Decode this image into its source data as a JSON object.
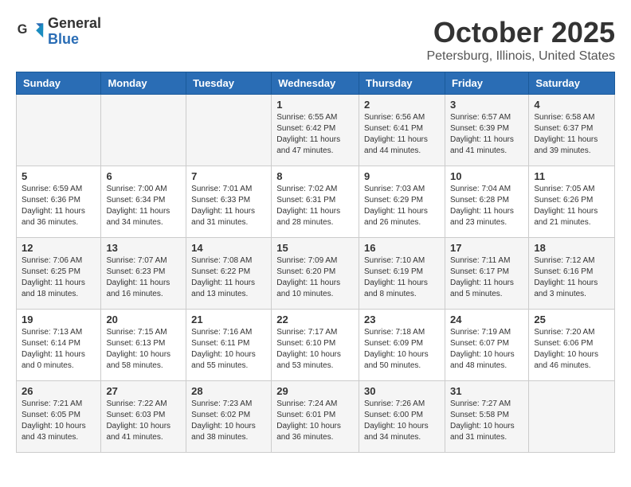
{
  "header": {
    "logo_line1": "General",
    "logo_line2": "Blue",
    "month": "October 2025",
    "location": "Petersburg, Illinois, United States"
  },
  "weekdays": [
    "Sunday",
    "Monday",
    "Tuesday",
    "Wednesday",
    "Thursday",
    "Friday",
    "Saturday"
  ],
  "weeks": [
    [
      {
        "day": "",
        "info": ""
      },
      {
        "day": "",
        "info": ""
      },
      {
        "day": "",
        "info": ""
      },
      {
        "day": "1",
        "info": "Sunrise: 6:55 AM\nSunset: 6:42 PM\nDaylight: 11 hours\nand 47 minutes."
      },
      {
        "day": "2",
        "info": "Sunrise: 6:56 AM\nSunset: 6:41 PM\nDaylight: 11 hours\nand 44 minutes."
      },
      {
        "day": "3",
        "info": "Sunrise: 6:57 AM\nSunset: 6:39 PM\nDaylight: 11 hours\nand 41 minutes."
      },
      {
        "day": "4",
        "info": "Sunrise: 6:58 AM\nSunset: 6:37 PM\nDaylight: 11 hours\nand 39 minutes."
      }
    ],
    [
      {
        "day": "5",
        "info": "Sunrise: 6:59 AM\nSunset: 6:36 PM\nDaylight: 11 hours\nand 36 minutes."
      },
      {
        "day": "6",
        "info": "Sunrise: 7:00 AM\nSunset: 6:34 PM\nDaylight: 11 hours\nand 34 minutes."
      },
      {
        "day": "7",
        "info": "Sunrise: 7:01 AM\nSunset: 6:33 PM\nDaylight: 11 hours\nand 31 minutes."
      },
      {
        "day": "8",
        "info": "Sunrise: 7:02 AM\nSunset: 6:31 PM\nDaylight: 11 hours\nand 28 minutes."
      },
      {
        "day": "9",
        "info": "Sunrise: 7:03 AM\nSunset: 6:29 PM\nDaylight: 11 hours\nand 26 minutes."
      },
      {
        "day": "10",
        "info": "Sunrise: 7:04 AM\nSunset: 6:28 PM\nDaylight: 11 hours\nand 23 minutes."
      },
      {
        "day": "11",
        "info": "Sunrise: 7:05 AM\nSunset: 6:26 PM\nDaylight: 11 hours\nand 21 minutes."
      }
    ],
    [
      {
        "day": "12",
        "info": "Sunrise: 7:06 AM\nSunset: 6:25 PM\nDaylight: 11 hours\nand 18 minutes."
      },
      {
        "day": "13",
        "info": "Sunrise: 7:07 AM\nSunset: 6:23 PM\nDaylight: 11 hours\nand 16 minutes."
      },
      {
        "day": "14",
        "info": "Sunrise: 7:08 AM\nSunset: 6:22 PM\nDaylight: 11 hours\nand 13 minutes."
      },
      {
        "day": "15",
        "info": "Sunrise: 7:09 AM\nSunset: 6:20 PM\nDaylight: 11 hours\nand 10 minutes."
      },
      {
        "day": "16",
        "info": "Sunrise: 7:10 AM\nSunset: 6:19 PM\nDaylight: 11 hours\nand 8 minutes."
      },
      {
        "day": "17",
        "info": "Sunrise: 7:11 AM\nSunset: 6:17 PM\nDaylight: 11 hours\nand 5 minutes."
      },
      {
        "day": "18",
        "info": "Sunrise: 7:12 AM\nSunset: 6:16 PM\nDaylight: 11 hours\nand 3 minutes."
      }
    ],
    [
      {
        "day": "19",
        "info": "Sunrise: 7:13 AM\nSunset: 6:14 PM\nDaylight: 11 hours\nand 0 minutes."
      },
      {
        "day": "20",
        "info": "Sunrise: 7:15 AM\nSunset: 6:13 PM\nDaylight: 10 hours\nand 58 minutes."
      },
      {
        "day": "21",
        "info": "Sunrise: 7:16 AM\nSunset: 6:11 PM\nDaylight: 10 hours\nand 55 minutes."
      },
      {
        "day": "22",
        "info": "Sunrise: 7:17 AM\nSunset: 6:10 PM\nDaylight: 10 hours\nand 53 minutes."
      },
      {
        "day": "23",
        "info": "Sunrise: 7:18 AM\nSunset: 6:09 PM\nDaylight: 10 hours\nand 50 minutes."
      },
      {
        "day": "24",
        "info": "Sunrise: 7:19 AM\nSunset: 6:07 PM\nDaylight: 10 hours\nand 48 minutes."
      },
      {
        "day": "25",
        "info": "Sunrise: 7:20 AM\nSunset: 6:06 PM\nDaylight: 10 hours\nand 46 minutes."
      }
    ],
    [
      {
        "day": "26",
        "info": "Sunrise: 7:21 AM\nSunset: 6:05 PM\nDaylight: 10 hours\nand 43 minutes."
      },
      {
        "day": "27",
        "info": "Sunrise: 7:22 AM\nSunset: 6:03 PM\nDaylight: 10 hours\nand 41 minutes."
      },
      {
        "day": "28",
        "info": "Sunrise: 7:23 AM\nSunset: 6:02 PM\nDaylight: 10 hours\nand 38 minutes."
      },
      {
        "day": "29",
        "info": "Sunrise: 7:24 AM\nSunset: 6:01 PM\nDaylight: 10 hours\nand 36 minutes."
      },
      {
        "day": "30",
        "info": "Sunrise: 7:26 AM\nSunset: 6:00 PM\nDaylight: 10 hours\nand 34 minutes."
      },
      {
        "day": "31",
        "info": "Sunrise: 7:27 AM\nSunset: 5:58 PM\nDaylight: 10 hours\nand 31 minutes."
      },
      {
        "day": "",
        "info": ""
      }
    ]
  ]
}
